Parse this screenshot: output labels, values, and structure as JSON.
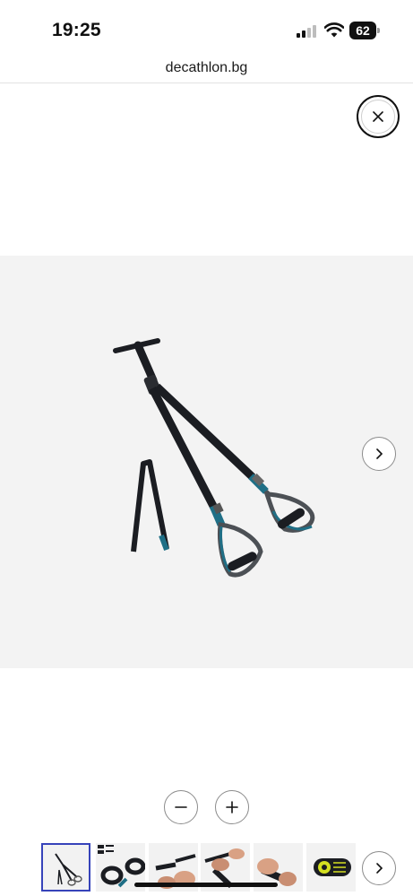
{
  "status_bar": {
    "time": "19:25",
    "battery": "62"
  },
  "browser": {
    "url": "decathlon.bg"
  },
  "viewer": {
    "close_icon": "close-icon",
    "next_icon": "chevron-right-icon",
    "zoom_out_icon": "minus-icon",
    "zoom_in_icon": "plus-icon",
    "selected_thumbnail": 1,
    "thumbnail_count": 6
  },
  "colors": {
    "accent": "#3643ba",
    "stage_bg": "#f3f3f3",
    "strap": "#1b1d22",
    "strap_accent": "#1f6f86"
  }
}
